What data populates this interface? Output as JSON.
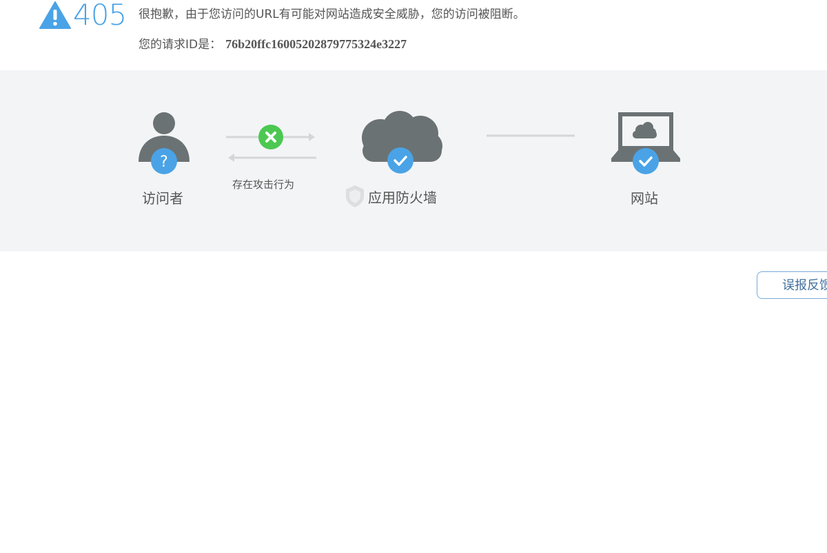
{
  "error": {
    "code": "405",
    "message": "很抱歉，由于您访问的URL有可能对网站造成安全威胁，您的访问被阻断。",
    "request_label": "您的请求ID是：",
    "request_id": "76b20ffc16005202879775324e3227"
  },
  "diagram": {
    "visitor_label": "访问者",
    "attack_label": "存在攻击行为",
    "firewall_label": "应用防火墙",
    "website_label": "网站"
  },
  "actions": {
    "feedback_label": "误报反馈"
  },
  "colors": {
    "accent_blue": "#4aa3e6",
    "gray_icon": "#6b7273",
    "block_green": "#4cc852",
    "band_bg": "#f3f4f6"
  },
  "icons": [
    "warning-icon",
    "visitor-icon",
    "question-icon",
    "block-x-icon",
    "cloud-firewall-icon",
    "check-icon",
    "shield-icon",
    "laptop-website-icon"
  ]
}
